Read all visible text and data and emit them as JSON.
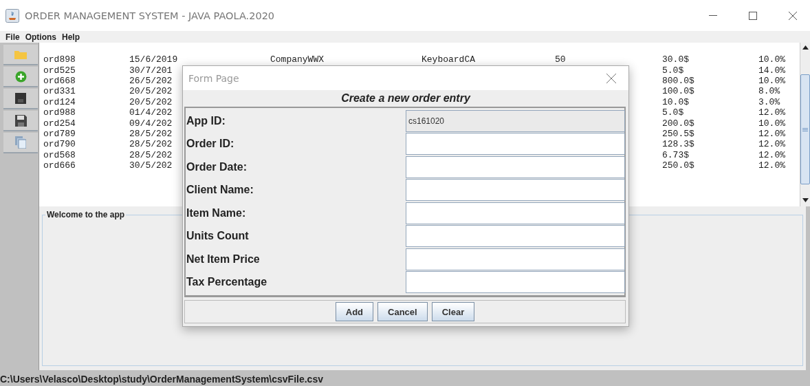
{
  "window": {
    "title": "ORDER MANAGEMENT SYSTEM - JAVA PAOLA.2020"
  },
  "menu": [
    "File",
    "Options",
    "Help"
  ],
  "toolbar": [
    {
      "kind": "folder"
    },
    {
      "kind": "add"
    },
    {
      "kind": "disk"
    },
    {
      "kind": "save"
    },
    {
      "kind": "pages"
    }
  ],
  "table": {
    "rows": [
      {
        "column_1": "ord898",
        "column_2": "15/6/2019",
        "column_3": "CompanyWWX",
        "column_4": "KeyboardCA",
        "column_5": "50",
        "column_6": "30.0$",
        "column_7": "10.0%"
      },
      {
        "column_1": "ord525",
        "column_2": "30/7/201",
        "column_6": "5.0$",
        "column_7": "14.0%"
      },
      {
        "column_1": "ord668",
        "column_2": "26/5/202",
        "column_6": "800.0$",
        "column_7": "10.0%"
      },
      {
        "column_1": "ord331",
        "column_2": "20/5/202",
        "column_6": "100.0$",
        "column_7": "8.0%"
      },
      {
        "column_1": "ord124",
        "column_2": "20/5/202",
        "column_6": "10.0$",
        "column_7": "3.0%"
      },
      {
        "column_1": "ord988",
        "column_2": "01/4/202",
        "column_6": "5.0$",
        "column_7": "12.0%"
      },
      {
        "column_1": "ord254",
        "column_2": "09/4/202",
        "column_6": "200.0$",
        "column_7": "10.0%"
      },
      {
        "column_1": "ord789",
        "column_2": "28/5/202",
        "column_6": "250.5$",
        "column_7": "12.0%"
      },
      {
        "column_1": "ord790",
        "column_2": "28/5/202",
        "column_6": "128.3$",
        "column_7": "12.0%"
      },
      {
        "column_1": "ord568",
        "column_2": "28/5/202",
        "column_6": "6.73$",
        "column_7": "12.0%"
      },
      {
        "column_1": "ord666",
        "column_2": "30/5/202",
        "column_6": "250.0$",
        "column_7": "12.0%"
      }
    ]
  },
  "panel": {
    "title": "Welcome to the app"
  },
  "dialog": {
    "title": "Form Page",
    "heading": "Create a new order entry",
    "fields": [
      {
        "label": "App ID:",
        "value": "cs161020",
        "disabled": true
      },
      {
        "label": "Order ID:",
        "disabled": false
      },
      {
        "label": "Order Date:",
        "disabled": false
      },
      {
        "label": "Client Name:",
        "disabled": false
      },
      {
        "label": "Item Name:",
        "disabled": false
      },
      {
        "label": "Units Count",
        "disabled": false
      },
      {
        "label": "Net Item Price",
        "disabled": false
      },
      {
        "label": "Tax Percentage",
        "disabled": false
      }
    ],
    "buttons": [
      "Add",
      "Cancel",
      "Clear"
    ]
  },
  "status_bar": {
    "path": "C:\\Users\\Velasco\\Desktop\\study\\OrderManagementSystem\\csvFile.csv"
  }
}
